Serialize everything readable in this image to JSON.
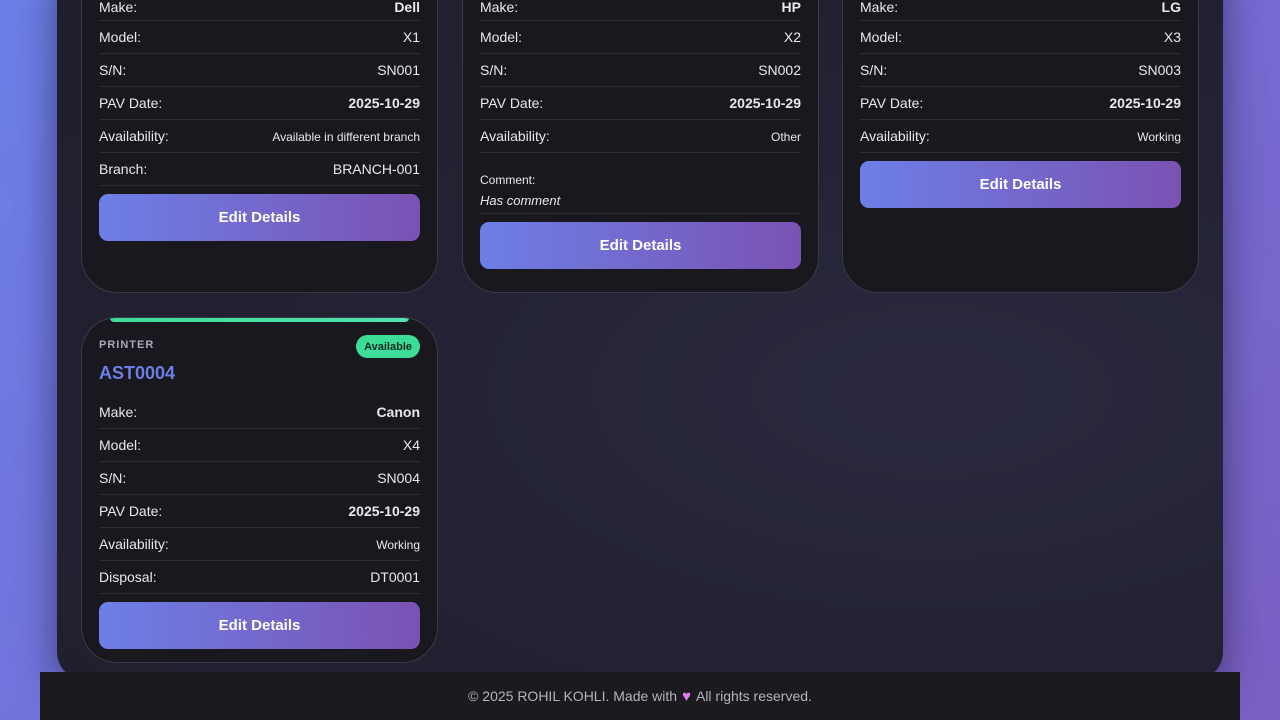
{
  "cards": [
    {
      "make_label": "Make:",
      "make": "Dell",
      "model_label": "Model:",
      "model": "X1",
      "sn_label": "S/N:",
      "sn": "SN001",
      "pav_label": "PAV Date:",
      "pav": "2025-10-29",
      "avail_label": "Availability:",
      "avail": "Available in different branch",
      "branch_label": "Branch:",
      "branch": "BRANCH-001",
      "button": "Edit Details"
    },
    {
      "make_label": "Make:",
      "make": "HP",
      "model_label": "Model:",
      "model": "X2",
      "sn_label": "S/N:",
      "sn": "SN002",
      "pav_label": "PAV Date:",
      "pav": "2025-10-29",
      "avail_label": "Availability:",
      "avail": "Other",
      "comment_label": "Comment:",
      "comment": "Has comment",
      "button": "Edit Details"
    },
    {
      "make_label": "Make:",
      "make": "LG",
      "model_label": "Model:",
      "model": "X3",
      "sn_label": "S/N:",
      "sn": "SN003",
      "pav_label": "PAV Date:",
      "pav": "2025-10-29",
      "avail_label": "Availability:",
      "avail": "Working",
      "button": "Edit Details"
    },
    {
      "type": "PRINTER",
      "badge": "Available",
      "asset_id": "AST0004",
      "make_label": "Make:",
      "make": "Canon",
      "model_label": "Model:",
      "model": "X4",
      "sn_label": "S/N:",
      "sn": "SN004",
      "pav_label": "PAV Date:",
      "pav": "2025-10-29",
      "avail_label": "Availability:",
      "avail": "Working",
      "disposal_label": "Disposal:",
      "disposal": "DT0001",
      "button": "Edit Details"
    }
  ],
  "footer": {
    "prefix": "© 2025 ROHIL KOHLI. Made with",
    "suffix": "All rights reserved.",
    "heart_icon": "heart-icon"
  },
  "colors": {
    "accent": "#6d7fe6",
    "badge": "#3ddc97",
    "heart": "#e879f9"
  }
}
